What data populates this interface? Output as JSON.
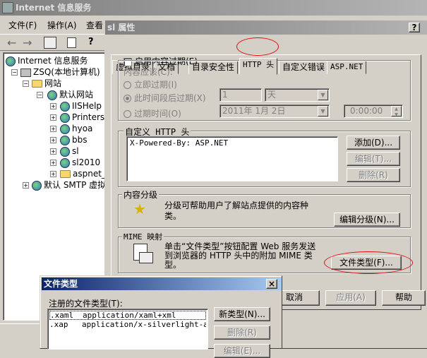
{
  "mmc": {
    "title": "Internet 信息服务",
    "menu": [
      "文件(F)",
      "操作(A)",
      "查看"
    ],
    "tree": [
      {
        "label": "Internet 信息服务",
        "type": "globe",
        "level": 0
      },
      {
        "label": "ZSQ(本地计算机)",
        "type": "pc",
        "level": 1
      },
      {
        "label": "网站",
        "type": "folder",
        "level": 2
      },
      {
        "label": "默认网站",
        "type": "globe",
        "level": 3
      },
      {
        "label": "IISHelp",
        "type": "globe",
        "level": 4
      },
      {
        "label": "Printers",
        "type": "globe",
        "level": 4
      },
      {
        "label": "hyoa",
        "type": "globe",
        "level": 4
      },
      {
        "label": "bbs",
        "type": "globe",
        "level": 4
      },
      {
        "label": "sl",
        "type": "globe",
        "level": 4
      },
      {
        "label": "sl2010",
        "type": "globe",
        "level": 4
      },
      {
        "label": "aspnet_c",
        "type": "folder",
        "level": 4
      },
      {
        "label": "默认 SMTP 虚拟",
        "type": "globe",
        "level": 1
      }
    ]
  },
  "props": {
    "title": "sl 属性",
    "help": "?",
    "close": "×",
    "tabs": [
      "虚拟目录",
      "文档",
      "目录安全性",
      "HTTP 头",
      "自定义错误",
      "ASP.NET"
    ],
    "expire": {
      "checkbox_label": "启用内容过期(E)",
      "group_label": "内容应该(C):",
      "opt_now": "立即过期(I)",
      "opt_after": "此时间段后过期(X)",
      "opt_at": "过期时间(O)",
      "num_value": "1",
      "unit_value": "天",
      "date_value": "2011年 1月 2日",
      "time_value": "0:00:00"
    },
    "custom_headers": {
      "group_label": "自定义 HTTP 头",
      "items": [
        "X-Powered-By: ASP.NET"
      ],
      "add": "添加(D)...",
      "edit": "编辑(T)...",
      "delete": "删除(R)"
    },
    "rating": {
      "group_label": "内容分级",
      "desc": "分级可帮助用户了解站点提供的内容种类。",
      "edit": "编辑分级(N)..."
    },
    "mime": {
      "group_label": "MIME 映射",
      "desc": "单击“文件类型”按钮配置 Web 服务发送到浏览器的 HTTP 头中的附加 MIME 类型。",
      "button": "文件类型(F)..."
    },
    "cancel": "取消",
    "apply": "应用(A)",
    "helpbtn": "帮助"
  },
  "filetypes": {
    "title": "文件类型",
    "close": "×",
    "label": "注册的文件类型(T):",
    "rows": [
      {
        "ext": ".xaml",
        "mime": "application/xaml+xml"
      },
      {
        "ext": ".xap",
        "mime": "application/x-silverlight-app"
      }
    ],
    "new": "新类型(N)...",
    "delete": "删除(R)",
    "edit": "编辑(E)..."
  }
}
